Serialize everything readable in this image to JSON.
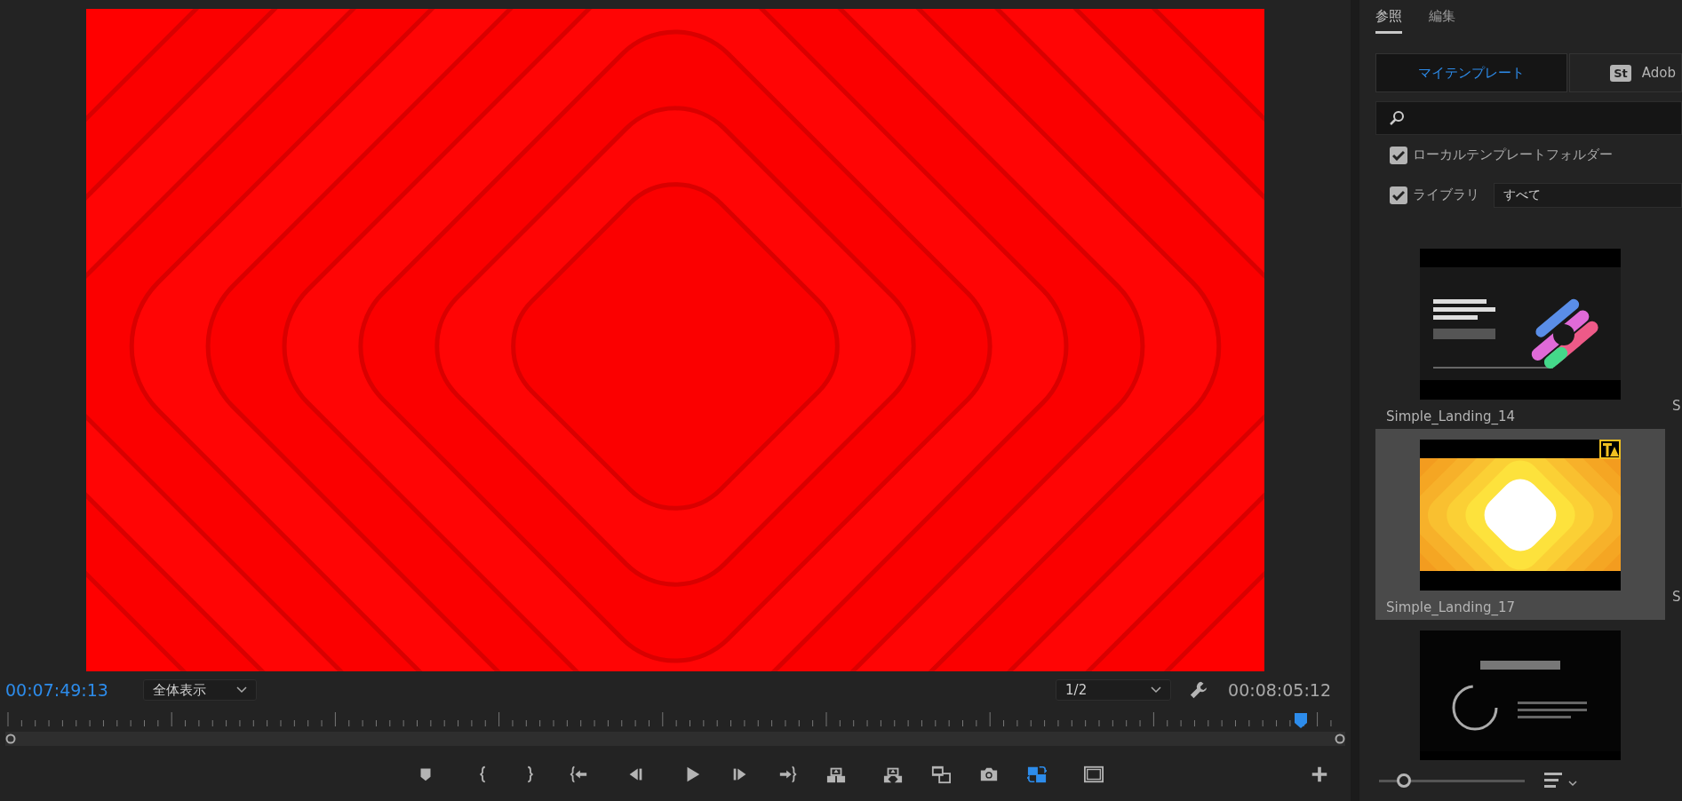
{
  "monitor": {
    "current_timecode": "00:07:49:13",
    "zoom_select": "全体表示",
    "resolution_select": "1/2",
    "duration_timecode": "00:08:05:12",
    "playhead": {
      "level": 0.967
    },
    "transport": [
      {
        "kind": "marker",
        "on": false
      },
      {
        "kind": "mark-in",
        "on": false
      },
      {
        "kind": "mark-out",
        "on": false
      },
      {
        "kind": "go-to-in",
        "on": false
      },
      {
        "kind": "step-back",
        "on": false
      },
      {
        "kind": "play",
        "on": false
      },
      {
        "kind": "step-forward",
        "on": false
      },
      {
        "kind": "go-to-out",
        "on": false
      },
      {
        "kind": "lift",
        "on": false
      },
      {
        "kind": "extract",
        "on": false
      },
      {
        "kind": "film-strip",
        "on": false
      },
      {
        "kind": "camera",
        "on": false
      },
      {
        "kind": "swap",
        "on": true
      },
      {
        "kind": "frame",
        "on": false
      }
    ]
  },
  "panel": {
    "tabs": [
      {
        "label": "参照",
        "selected": true
      },
      {
        "label": "編集",
        "selected": false
      }
    ],
    "sources": [
      {
        "label": "マイテンプレート",
        "selected": true
      },
      {
        "label": "Adob",
        "badge": "St",
        "selected": false
      }
    ],
    "filters": [
      {
        "label": "ローカルテンプレートフォルダー",
        "checked": true
      },
      {
        "label": "ライブラリ",
        "checked": true,
        "select": "すべて"
      }
    ],
    "templates": [
      {
        "kind": "dark-landing",
        "label": "Simple_Landing_14",
        "selected": false,
        "warning": false,
        "neighbor_label": "S"
      },
      {
        "kind": "yellow-landing",
        "label": "Simple_Landing_17",
        "selected": true,
        "warning": true,
        "neighbor_label": "S"
      },
      {
        "kind": "pie-chart",
        "selected": false,
        "warning": false
      }
    ],
    "thumbnail_size": {
      "level": 0.17
    }
  }
}
